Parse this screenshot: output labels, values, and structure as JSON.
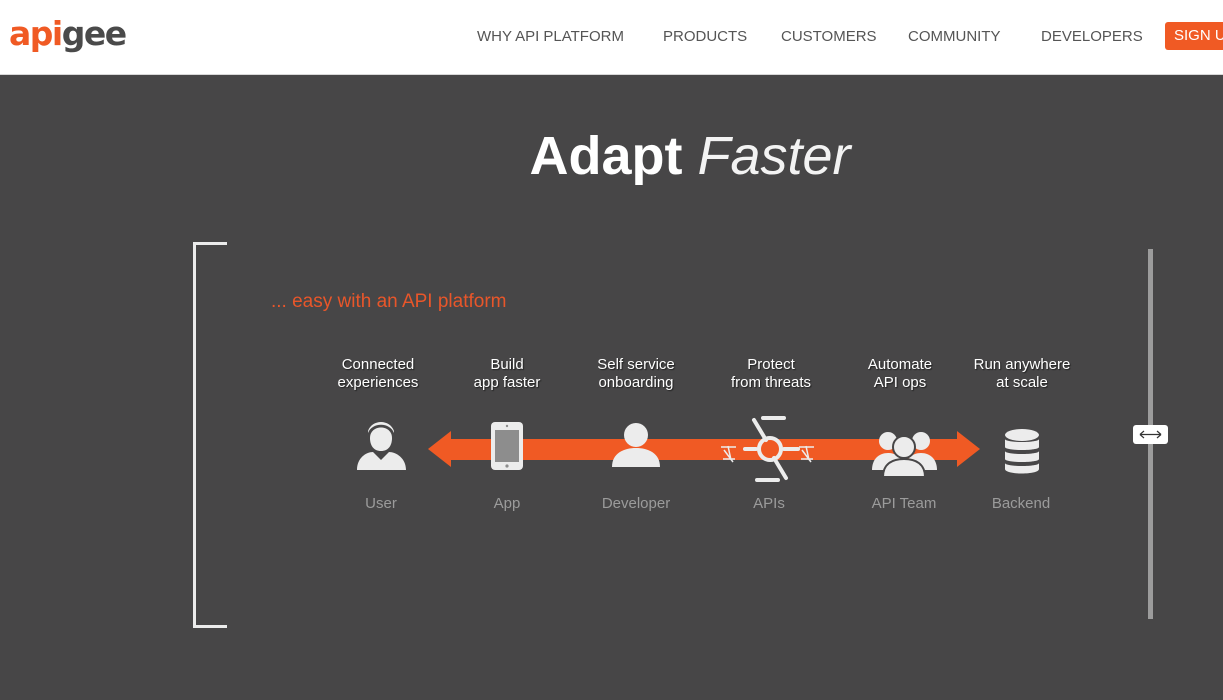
{
  "header": {
    "logo_part1": "api",
    "logo_part2": "gee",
    "nav": [
      {
        "label": "WHY API PLATFORM"
      },
      {
        "label": "PRODUCTS"
      },
      {
        "label": "CUSTOMERS"
      },
      {
        "label": "COMMUNITY"
      },
      {
        "label": "DEVELOPERS"
      }
    ],
    "signup_label": "SIGN UP"
  },
  "hero": {
    "title_bold": "Adapt",
    "title_light": "Faster"
  },
  "panel": {
    "tagline": "... easy with an API platform",
    "stages": [
      {
        "caption1": "Connected",
        "caption2": "experiences",
        "label": "User",
        "icon": "user-icon"
      },
      {
        "caption1": "Build",
        "caption2": "app faster",
        "label": "App",
        "icon": "tablet-icon"
      },
      {
        "caption1": "Self service",
        "caption2": "onboarding",
        "label": "Developer",
        "icon": "developer-icon"
      },
      {
        "caption1": "Protect",
        "caption2": "from threats",
        "label": "APIs",
        "icon": "api-shield-icon"
      },
      {
        "caption1": "Automate",
        "caption2": "API ops",
        "label": "API Team",
        "icon": "team-icon"
      },
      {
        "caption1": "Run anywhere",
        "caption2": "at scale",
        "label": "Backend",
        "icon": "database-icon"
      }
    ]
  },
  "colors": {
    "accent": "#f05a24",
    "background": "#474647"
  }
}
